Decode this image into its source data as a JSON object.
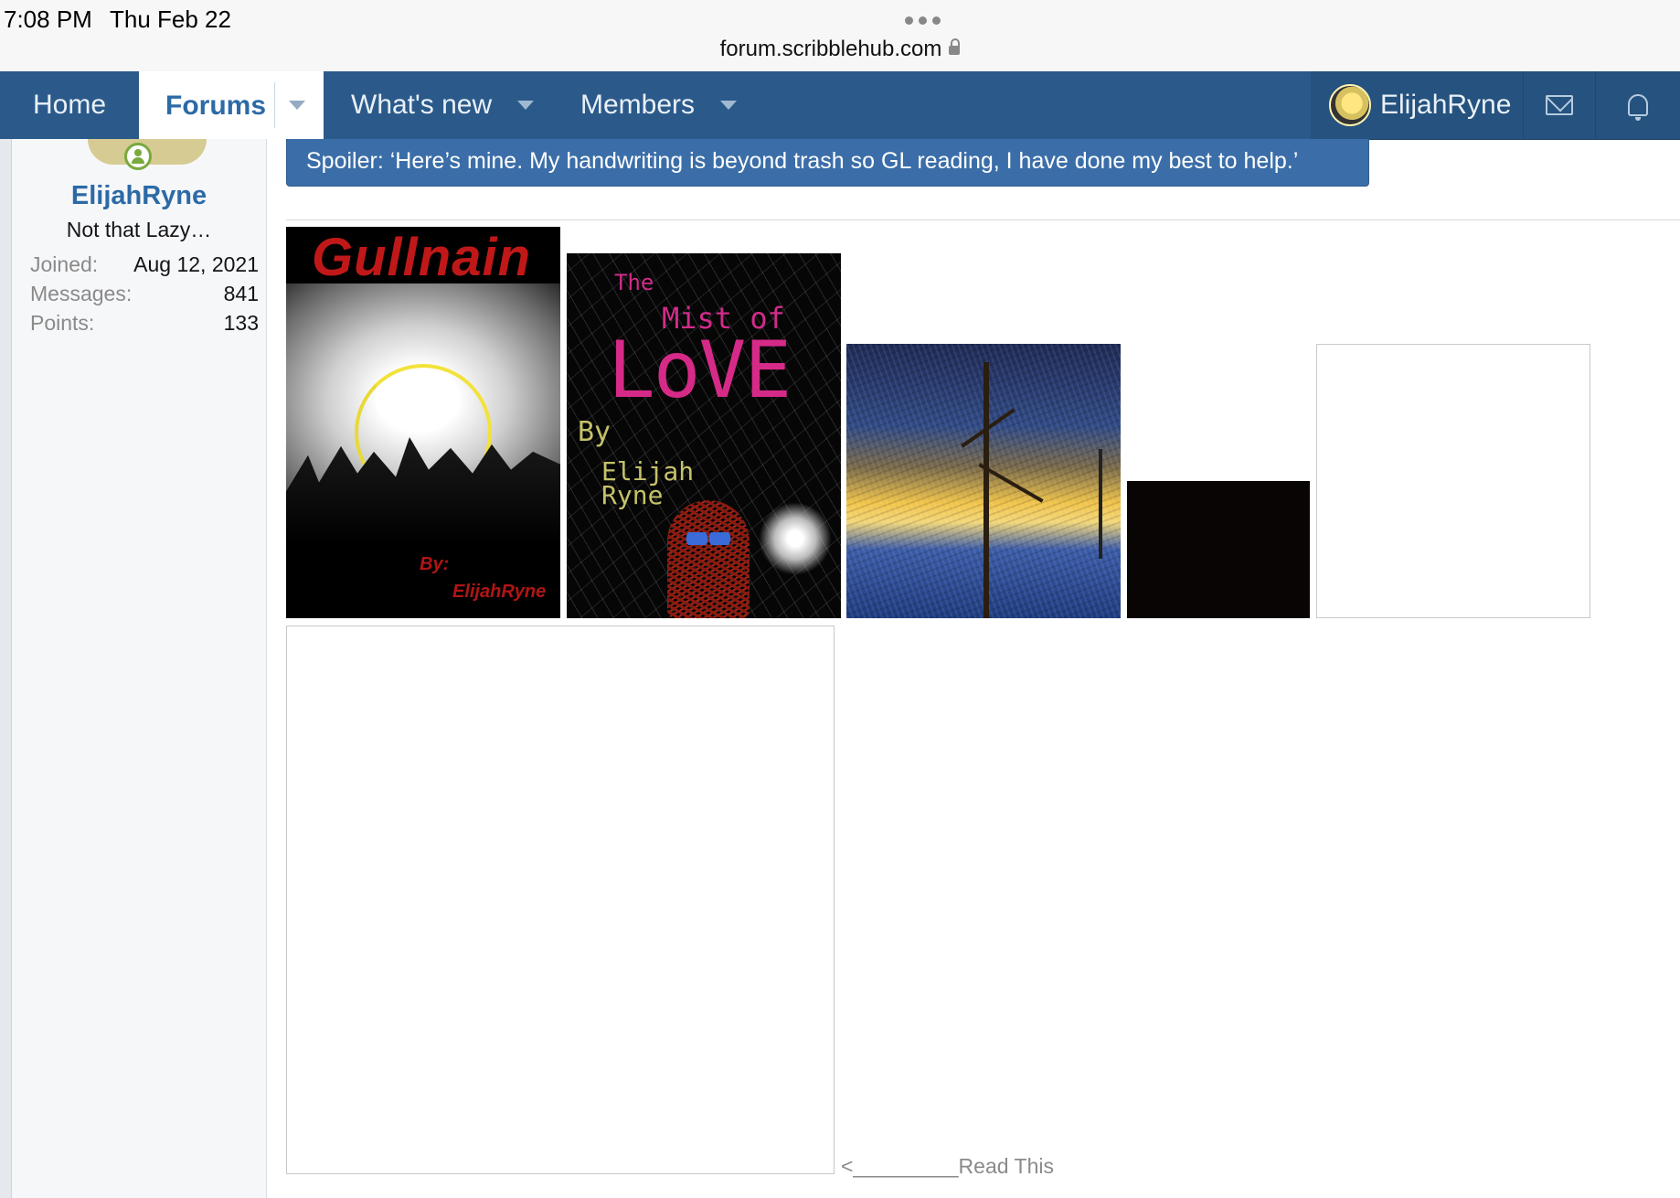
{
  "status_bar": {
    "time": "7:08 PM",
    "date": "Thu Feb 22",
    "url": "forum.scribblehub.com"
  },
  "nav": {
    "home": "Home",
    "forums": "Forums",
    "whats_new": "What's new",
    "members": "Members",
    "username": "ElijahRyne",
    "colors": {
      "bar": "#2b5a8a",
      "active_tab": "#ffffff",
      "active_text": "#2c6aa6"
    },
    "icons": [
      "chevron-down-icon",
      "mail-icon",
      "bell-icon"
    ]
  },
  "user_card": {
    "username": "ElijahRyne",
    "title": "Not that Lazy…",
    "stats": [
      {
        "label": "Joined:",
        "value": "Aug 12, 2021"
      },
      {
        "label": "Messages:",
        "value": "841"
      },
      {
        "label": "Points:",
        "value": "133"
      }
    ]
  },
  "post": {
    "spoiler_label": "Spoiler: ‘Here’s mine. My handwriting is beyond trash so GL reading, I have done my best to help.’",
    "images": [
      {
        "name": "cover-gullnain",
        "title": "Gullnain",
        "by": "By:",
        "author": "ElijahRyne"
      },
      {
        "name": "cover-mist-of-love",
        "the": "The",
        "mist_of": "Mist of",
        "love": "LoVE",
        "by": "By",
        "author_first": "Elijah",
        "author_last": "Ryne"
      },
      {
        "name": "painting-night-street"
      },
      {
        "name": "dark-image"
      },
      {
        "name": "blank-image"
      },
      {
        "name": "large-blank-image"
      }
    ],
    "read_this": "<_________Read This"
  }
}
